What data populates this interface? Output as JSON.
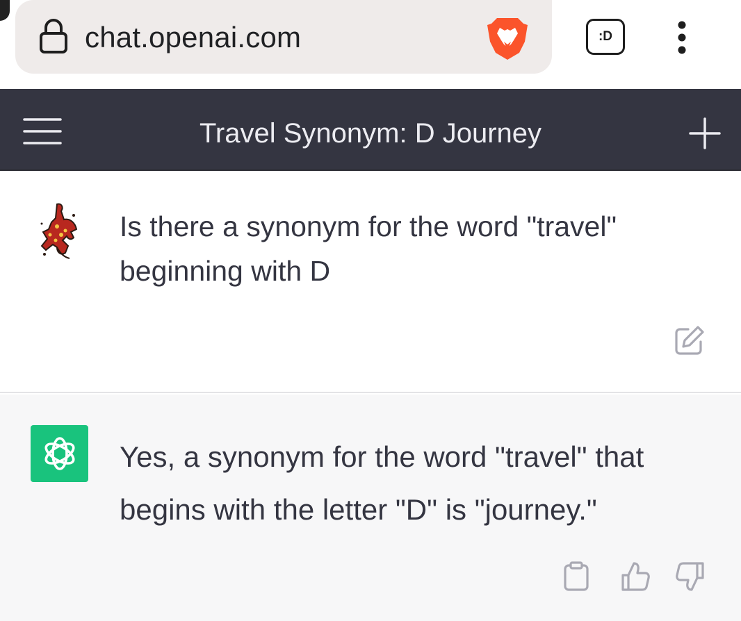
{
  "browser": {
    "url": "chat.openai.com",
    "tab_switcher_label": ":D",
    "icons": {
      "lock": "lock-icon",
      "brave": "brave-lion-icon",
      "menu": "more-vertical-icon"
    }
  },
  "header": {
    "title": "Travel Synonym: D Journey",
    "icons": {
      "menu": "hamburger-icon",
      "new_chat": "plus-icon"
    }
  },
  "conversation": {
    "user_message": "Is there a synonym for the word \"travel\" beginning with D",
    "assistant_message": "Yes, a synonym for the word \"travel\" that begins with the letter \"D\" is \"journey.\"",
    "icons": {
      "edit": "edit-icon",
      "copy": "clipboard-icon",
      "like": "thumbs-up-icon",
      "dislike": "thumbs-down-icon",
      "assistant_avatar": "openai-logo-icon"
    }
  },
  "colors": {
    "header_bg": "#343541",
    "assistant_avatar_bg": "#19c37d",
    "assistant_row_bg": "#f7f7f8",
    "text": "#343541",
    "brave_orange": "#fb542b"
  }
}
